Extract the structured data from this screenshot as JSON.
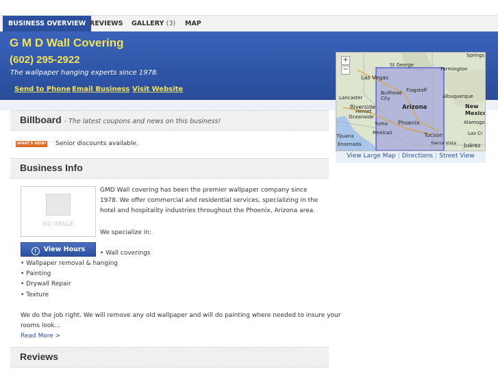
{
  "tabs": {
    "overview": "BUSINESS OVERVIEW",
    "reviews": "REVIEWS",
    "gallery": "GALLERY",
    "gallery_count": "(3)",
    "map": "MAP"
  },
  "business": {
    "name": "G M D Wall Covering",
    "phone": "(602) 295-2922",
    "tagline": "The wallpaper hanging experts since 1978."
  },
  "links": {
    "send_to_phone": "Send to Phone",
    "email_business": "Email Business",
    "visit_website": "Visit Website"
  },
  "billboard": {
    "title": "Billboard",
    "subtitle": "- The latest coupons and news on this business!",
    "badge": "WHAT'S NEW!",
    "item": "Senior discounts available."
  },
  "business_info": {
    "title": "Business Info",
    "no_image": "NO IMAGE",
    "view_hours": "View Hours",
    "description": "GMD Wall covering has been the premier wallpaper company since 1978. We offer commercial and residential services, specializing in the hotel and hospitality industries throughout the Phoenix, Arizona area.",
    "specialize": "We specialize in:",
    "services": [
      "• Wall coverings",
      "• Wallpaper removal & hanging",
      "• Painting",
      "• Drywall Repair",
      "• Texture"
    ],
    "closing_1": "We do the job right. We will remove any old wallpaper and will do painting where needed to insure your",
    "closing_2": "rooms look…",
    "read_more": "Read More >"
  },
  "reviews": {
    "title": "Reviews"
  },
  "map": {
    "view_large": "View Large Map",
    "directions": "Directions",
    "street_view": "Street View",
    "labels": [
      "St George",
      "Las Vegas",
      "Farmington",
      "Springs",
      "Flagstaff",
      "Bullhead City",
      "Lancaster",
      "Albuquerque",
      "Riverside",
      "Arizona",
      "New Mexico",
      "Oceanside",
      "Hemet",
      "Yuma",
      "Phoenix",
      "Alamogor",
      "Mexicali",
      "Tucson",
      "Las Cr",
      "Ensenada",
      "Sierra Vista",
      "Juárez",
      "Tijuana"
    ]
  }
}
